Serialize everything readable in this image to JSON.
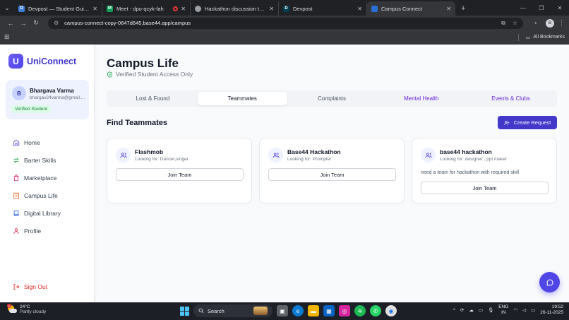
{
  "browser": {
    "tabs": [
      {
        "title": "Devpost — Student Guide for E",
        "favicon": "D",
        "color": "#3f7fd8",
        "active": false
      },
      {
        "title": "Meet - dpo-qcyk-fah",
        "favicon": "M",
        "color": "#0f9d58",
        "active": false
      },
      {
        "title": "Hackathon discussion topics",
        "favicon": "",
        "color": "#9aa0a6",
        "active": false
      },
      {
        "title": "Devpost",
        "favicon": "D",
        "color": "#003e54",
        "active": false
      },
      {
        "title": "Campus Connect",
        "favicon": "",
        "color": "#2b6fd6",
        "active": true
      }
    ],
    "url": "campus-connect-copy-0647d645.base44.app/campus",
    "bookmarks_label": "All Bookmarks"
  },
  "app": {
    "logo_letter": "U",
    "name": "UniConnect",
    "brand_color": "#4338ca",
    "user": {
      "initial": "B",
      "name": "Bhargava Varma",
      "email": "bhargav24varma@gmail....",
      "badge": "Verified Student"
    },
    "nav": [
      {
        "label": "Home",
        "icon": "home-icon",
        "color": "#4f46e5"
      },
      {
        "label": "Barter Skills",
        "icon": "swap-icon",
        "color": "#16a34a"
      },
      {
        "label": "Marketplace",
        "icon": "bag-icon",
        "color": "#db2777"
      },
      {
        "label": "Campus Life",
        "icon": "building-icon",
        "color": "#ea580c"
      },
      {
        "label": "Digital Library",
        "icon": "book-icon",
        "color": "#2563eb"
      },
      {
        "label": "Profile",
        "icon": "user-icon",
        "color": "#e11d48"
      }
    ],
    "signout": "Sign Out"
  },
  "page": {
    "title": "Campus Life",
    "subtitle": "Verified Student Access Only",
    "tabs": [
      "Lost & Found",
      "Teammates",
      "Complaints",
      "Mental Health",
      "Events & Clubs"
    ],
    "active_tab": "Teammates",
    "section_title": "Find Teammates",
    "create_button": "Create Request",
    "cards": [
      {
        "name": "Flashmob",
        "looking": "Looking for: Dancer,singer",
        "description": "",
        "button": "Join Team"
      },
      {
        "name": "Base44 Hackathon",
        "looking": "Looking for: Prompter",
        "description": "",
        "button": "Join Team"
      },
      {
        "name": "base44 hackathon",
        "looking": "Looking for: designer , ppt maker",
        "description": "need a team for hackathon with required skill",
        "button": "Join Team"
      }
    ]
  },
  "taskbar": {
    "temperature": "24°C",
    "weather": "Partly cloudy",
    "search": "Search",
    "lang1": "ENG",
    "lang2": "IN",
    "time": "19:52",
    "date": "26-11-2025"
  }
}
